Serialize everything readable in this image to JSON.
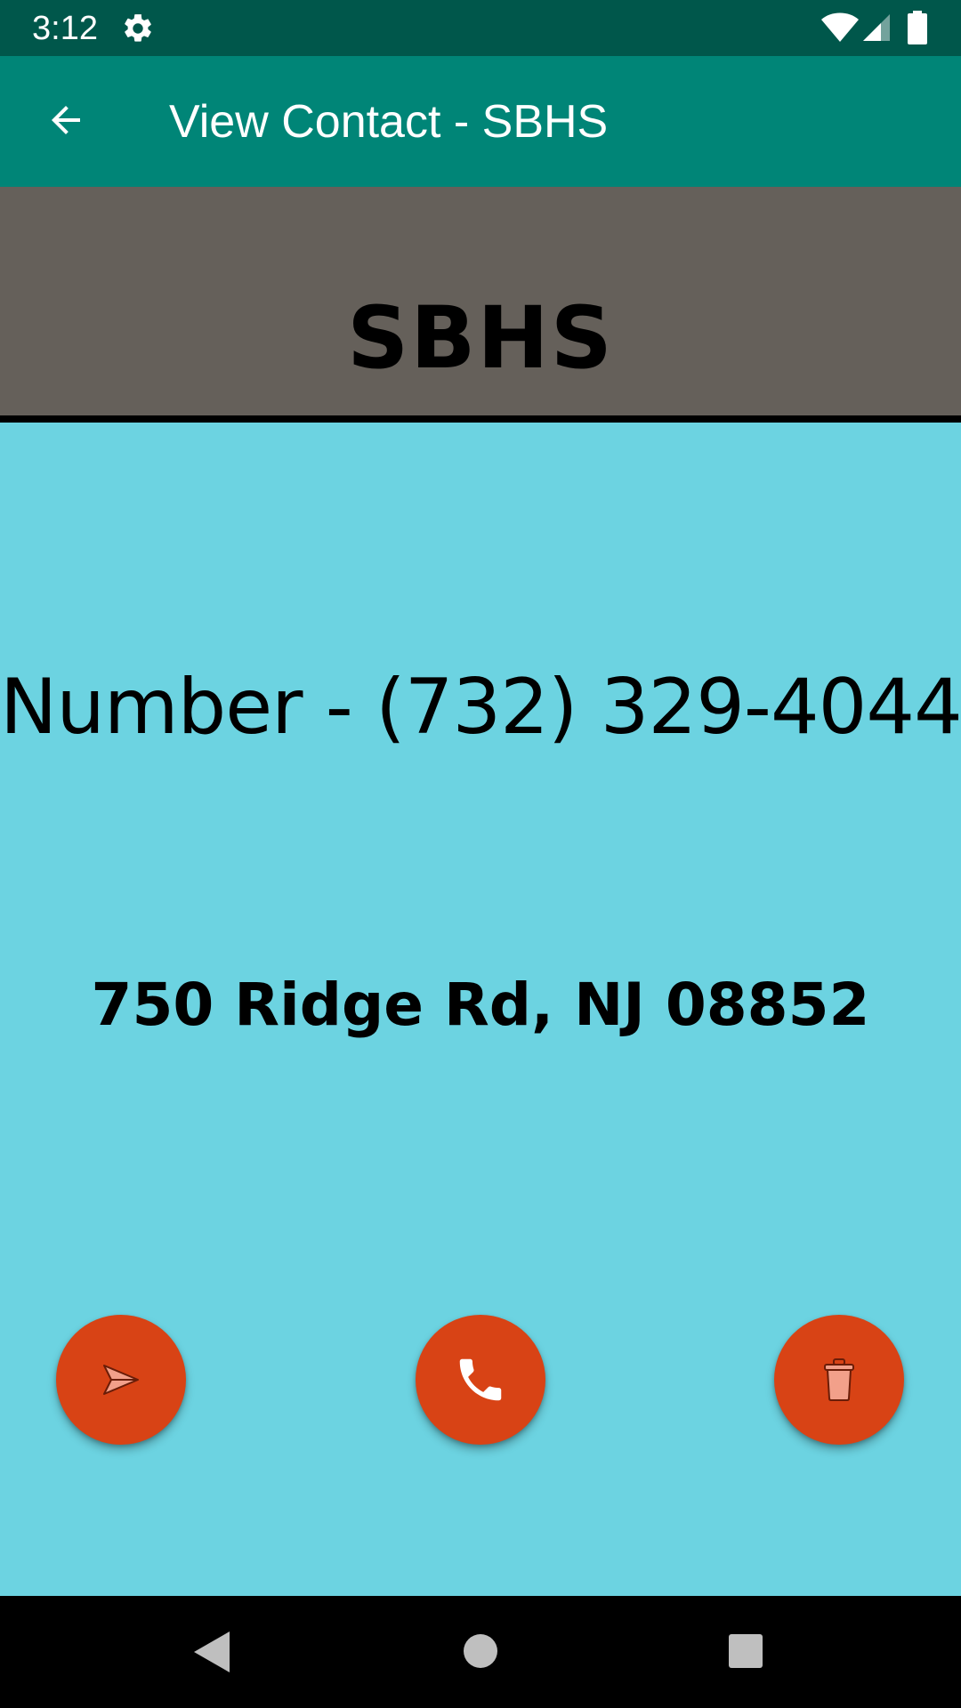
{
  "status_bar": {
    "time": "3:12",
    "icons": [
      "gear-icon",
      "wifi-icon",
      "signal-icon",
      "battery-icon"
    ]
  },
  "app_bar": {
    "title": "View Contact - SBHS",
    "back_icon": "arrow-back-icon"
  },
  "contact": {
    "name": "SBHS",
    "number_line": "Number - (732) 329-4044",
    "address": "750 Ridge Rd, NJ 08852"
  },
  "actions": [
    {
      "name": "send",
      "icon": "send-icon"
    },
    {
      "name": "call",
      "icon": "phone-icon"
    },
    {
      "name": "delete",
      "icon": "trash-icon"
    }
  ],
  "nav_bar": {
    "icons": [
      "nav-back-icon",
      "nav-home-icon",
      "nav-recents-icon"
    ]
  },
  "colors": {
    "status_bar": "#00574b",
    "app_bar": "#008577",
    "header_band": "#65605a",
    "content_background": "#6cd3e1",
    "fab": "#d84315"
  }
}
